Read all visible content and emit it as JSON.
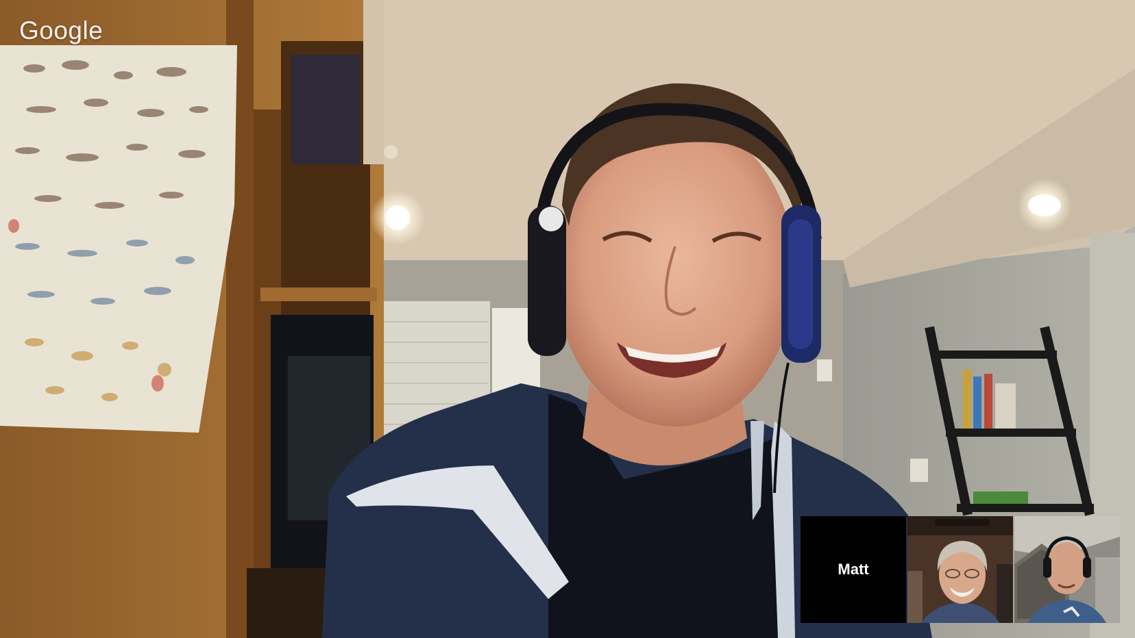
{
  "app": {
    "logo_text": "Google"
  },
  "filmstrip": {
    "participants": [
      {
        "name": "Matt",
        "video": "off",
        "tile_color": "#000000"
      },
      {
        "name": "",
        "video": "on",
        "avatar": "participant-smiling-glasses"
      },
      {
        "name": "",
        "video": "on",
        "avatar": "participant-headset"
      }
    ]
  }
}
